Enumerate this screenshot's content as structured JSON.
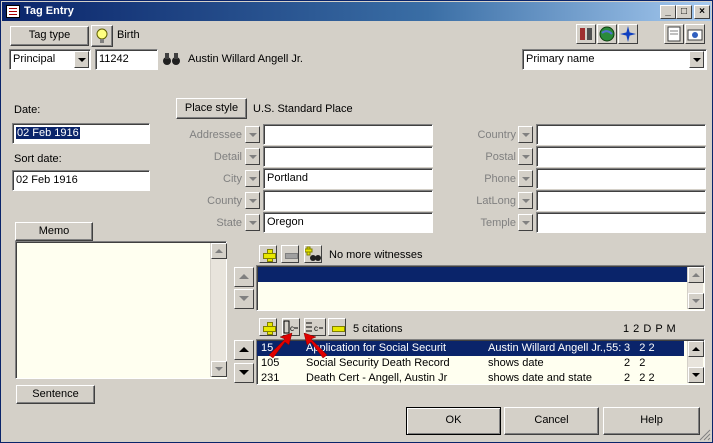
{
  "window": {
    "title": "Tag Entry"
  },
  "tag_type": {
    "button_label": "Tag type",
    "value": "Birth"
  },
  "principal": {
    "role": "Principal",
    "id": "11242",
    "name": "Austin Willard Angell Jr."
  },
  "name_type": {
    "value": "Primary name"
  },
  "date": {
    "label": "Date:",
    "value": "02 Feb 1916"
  },
  "sort_date": {
    "label": "Sort date:",
    "value": "02 Feb 1916"
  },
  "place": {
    "style_button": "Place style",
    "style_value": "U.S. Standard Place",
    "left_fields": [
      {
        "label": "Addressee",
        "value": ""
      },
      {
        "label": "Detail",
        "value": ""
      },
      {
        "label": "City",
        "value": "Portland"
      },
      {
        "label": "County",
        "value": ""
      },
      {
        "label": "State",
        "value": "Oregon"
      }
    ],
    "right_fields": [
      {
        "label": "Country",
        "value": ""
      },
      {
        "label": "Postal",
        "value": ""
      },
      {
        "label": "Phone",
        "value": ""
      },
      {
        "label": "LatLong",
        "value": ""
      },
      {
        "label": "Temple",
        "value": ""
      }
    ]
  },
  "memo": {
    "button_label": "Memo",
    "value": ""
  },
  "sentence": {
    "button_label": "Sentence"
  },
  "witnesses": {
    "status": "No more witnesses"
  },
  "citations": {
    "count_text": "5  citations",
    "columns_header": "1 2 D P M",
    "rows": [
      {
        "id": "15",
        "source": "Application for Social Securit",
        "detail": "Austin Willard Angell Jr.,55:",
        "flags": "3   2 2"
      },
      {
        "id": "105",
        "source": "Social Security Death Record",
        "detail": "shows date",
        "flags": "2   2"
      },
      {
        "id": "231",
        "source": "Death Cert - Angell, Austin Jr",
        "detail": "shows date and state",
        "flags": "2   2 2"
      }
    ]
  },
  "footer": {
    "ok": "OK",
    "cancel": "Cancel",
    "help": "Help"
  },
  "colors": {
    "title_bar": "#0a246a",
    "selection": "#0a246a",
    "face": "#d4d0c8",
    "annotation_arrow": "#e00000"
  }
}
